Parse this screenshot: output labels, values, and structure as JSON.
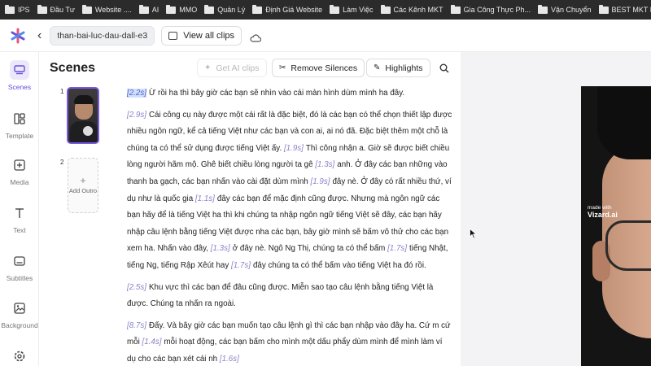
{
  "bookmarks": [
    "IPS",
    "Đầu Tư",
    "Website ....",
    "AI",
    "MMO",
    "Quản Lý",
    "Định Giá Website",
    "Làm Việc",
    "Các Kênh MKT",
    "Gia Công Thực Ph...",
    "Vận Chuyển",
    "BEST MKT PTL"
  ],
  "topbar": {
    "project_name": "than-bai-luc-dau-dall-e3",
    "view_clips_label": "View all clips"
  },
  "sidebar": {
    "items": [
      {
        "label": "Scenes",
        "icon": "scenes-icon"
      },
      {
        "label": "Template",
        "icon": "template-icon"
      },
      {
        "label": "Media",
        "icon": "media-icon"
      },
      {
        "label": "Text",
        "icon": "text-icon"
      },
      {
        "label": "Subtitles",
        "icon": "subtitles-icon"
      },
      {
        "label": "Background",
        "icon": "background-icon"
      },
      {
        "label": "",
        "icon": "settings-icon"
      }
    ]
  },
  "main": {
    "title": "Scenes",
    "get_ai_clips_label": "Get AI clips",
    "remove_silences_label": "Remove Silences",
    "highlights_label": "Highlights",
    "scene_1_number": "1",
    "scene_2_number": "2",
    "add_outro_plus": "+",
    "add_outro_label": "Add Outro"
  },
  "transcript": [
    [
      {
        "ts": "[2.2s]",
        "text": "Ừ rồi ha thì bây giờ các bạn sẽ nhìn vào cái màn hình dùm mình ha đây."
      }
    ],
    [
      {
        "ts": "[2.9s]",
        "text": "Cái công cụ này được một cái rất là đặc biệt, đó là các bạn có thể chọn thiết lập được nhiều ngôn ngữ, kể cả tiếng Việt như các bạn và con ai, ai nó đã. Đặc biệt thêm một chỗ là chúng ta có thể sử dụng được tiếng Việt ấy."
      },
      {
        "ts": "[1.9s]",
        "text": "Thì công nhận a. Giờ sẽ được biết chiều lòng người hãm mộ. Ghê biết chiều lòng người ta gê"
      },
      {
        "ts": "[1.3s]",
        "text": "anh. Ở đây các bạn những vào thanh ba gạch, các bạn nhấn vào cài đặt dùm mình"
      },
      {
        "ts": "[1.9s]",
        "text": "đây nè. Ở đây có rất nhiều thứ, ví dụ như là quốc gia"
      },
      {
        "ts": "[1.1s]",
        "text": "đây các bạn để mặc định cũng được. Nhưng mà ngôn ngữ các bạn hãy để là tiếng Việt ha thì khi chúng ta nhập ngôn ngữ tiếng Việt sẽ đây, các bạn hãy nhập câu lệnh bằng tiếng Việt được nha các bạn, bây giờ mình sẽ bấm vô thử cho các bạn xem ha. Nhấn vào đây,"
      },
      {
        "ts": "[1.3s]",
        "text": "ở đây nè. Ngô Ng Thị, chúng ta có thể bấm"
      },
      {
        "ts": "[1.7s]",
        "text": "tiếng Nhật, tiếng Ng, tiếng Rập Xêút hay"
      },
      {
        "ts": "[1.7s]",
        "text": "đây chúng ta có thể bấm vào tiếng Việt ha đó rồi."
      }
    ],
    [
      {
        "ts": "[2.5s]",
        "text": "Khu vực thì các bạn để đâu cũng được. Miễn sao tạo câu lệnh bằng tiếng Việt là được. Chúng ta nhấn ra ngoài."
      }
    ],
    [
      {
        "ts": "[8.7s]",
        "text": "Đấy. Và bây giờ các bạn muốn tạo câu lệnh gì thì các bạn nhập vào đây ha. Cứ m cứ mỗi"
      },
      {
        "ts": "[1.4s]",
        "text": "mỗi hoạt động, các bạn bấm cho mình một dấu phẩy dùm mình để mình làm ví dụ cho các bạn xét cái nh"
      },
      {
        "ts": "[1.6s]",
        "text": ""
      }
    ]
  ],
  "preview": {
    "watermark_small": "made with",
    "watermark_brand": "Vizard.ai"
  },
  "colors": {
    "accent": "#6b4fd8",
    "timestamp": "#8a84c9",
    "highlight": "#cfe0ff"
  }
}
